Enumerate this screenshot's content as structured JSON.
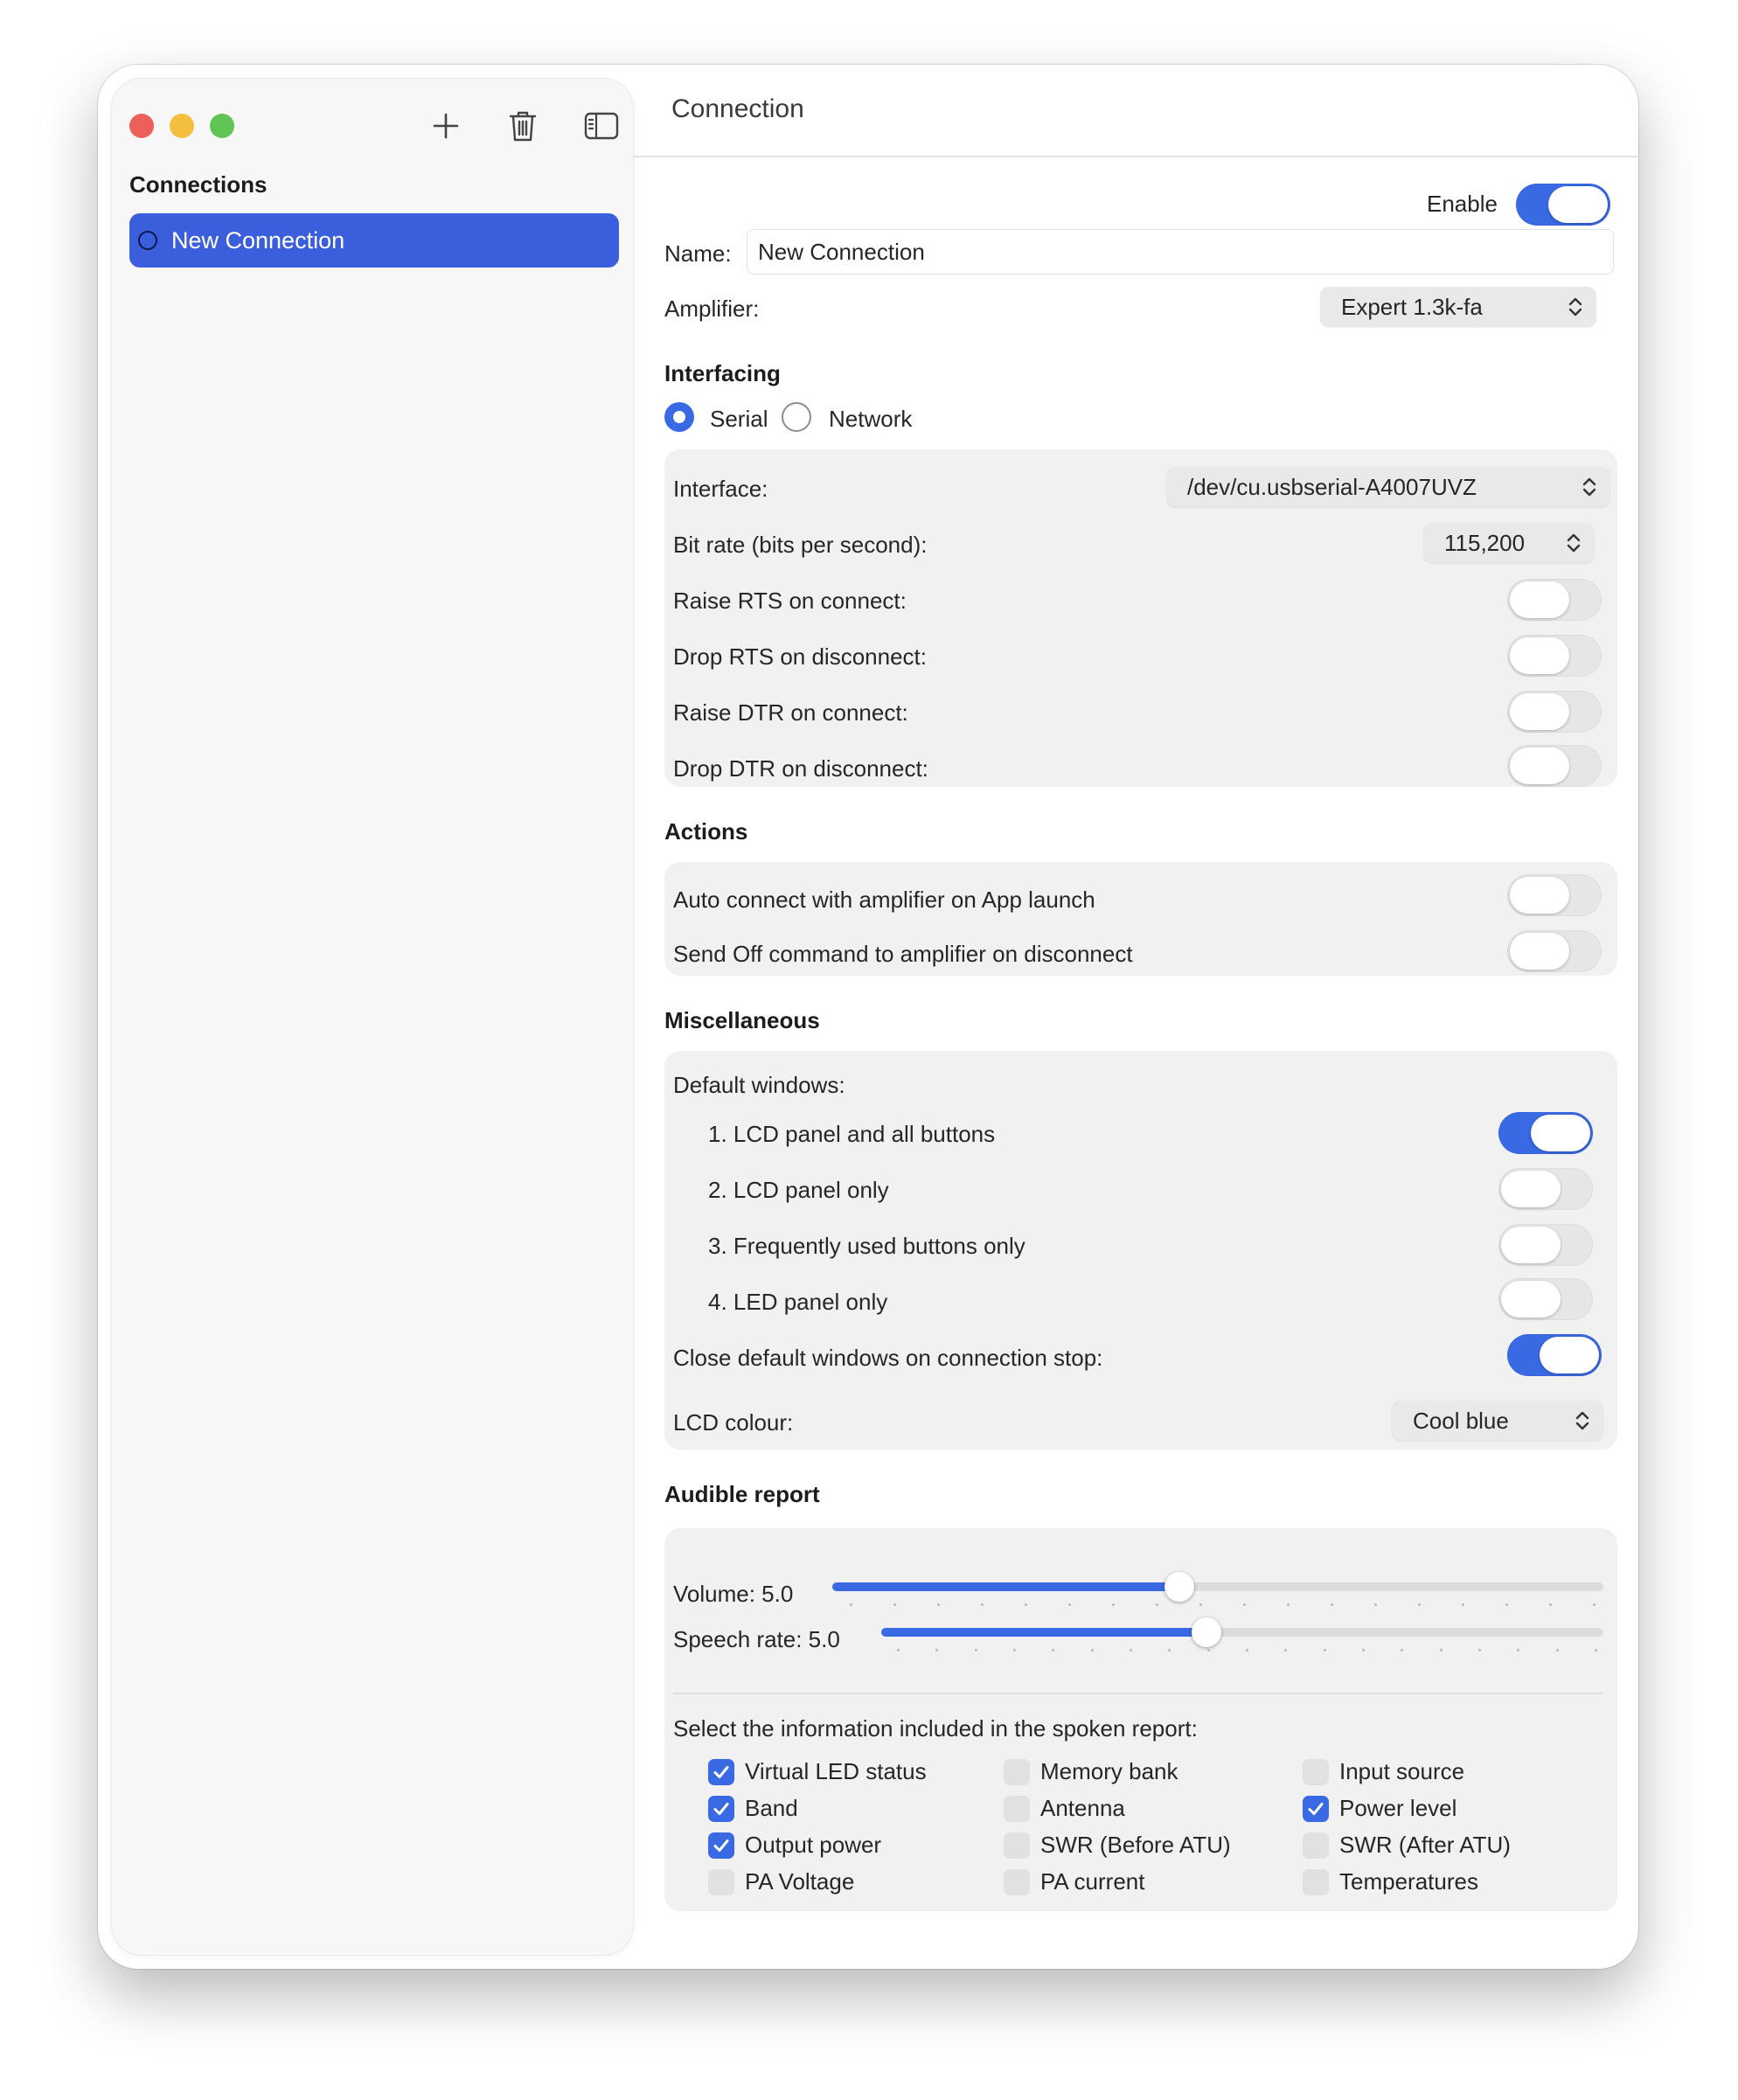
{
  "sidebar": {
    "heading": "Connections",
    "items": [
      {
        "label": "New Connection",
        "selected": true
      }
    ],
    "toolbar": {
      "add_icon": "plus-icon",
      "delete_icon": "trash-icon",
      "sidebar_icon": "sidebar-toggle-icon"
    }
  },
  "detail": {
    "title": "Connection",
    "enable": {
      "label": "Enable",
      "on": true
    },
    "name": {
      "label": "Name:",
      "value": "New Connection"
    },
    "amplifier": {
      "label": "Amplifier:",
      "value": "Expert 1.3k-fa"
    },
    "interfacing": {
      "heading": "Interfacing",
      "options": [
        {
          "label": "Serial",
          "selected": true
        },
        {
          "label": "Network",
          "selected": false
        }
      ],
      "interface": {
        "label": "Interface:",
        "value": "/dev/cu.usbserial-A4007UVZ"
      },
      "bitrate": {
        "label": "Bit rate (bits per second):",
        "value": "115,200"
      },
      "toggles": [
        {
          "label": "Raise RTS on connect:",
          "on": false
        },
        {
          "label": "Drop RTS on disconnect:",
          "on": false
        },
        {
          "label": "Raise DTR on connect:",
          "on": false
        },
        {
          "label": "Drop DTR on disconnect:",
          "on": false
        }
      ]
    },
    "actions": {
      "heading": "Actions",
      "toggles": [
        {
          "label": "Auto connect with amplifier on App launch",
          "on": false
        },
        {
          "label": "Send Off command to amplifier on disconnect",
          "on": false
        }
      ]
    },
    "misc": {
      "heading": "Miscellaneous",
      "default_windows_label": "Default windows:",
      "windows": [
        {
          "label": "1. LCD panel and all buttons",
          "on": true
        },
        {
          "label": "2. LCD panel only",
          "on": false
        },
        {
          "label": "3. Frequently used buttons only",
          "on": false
        },
        {
          "label": "4. LED panel only",
          "on": false
        }
      ],
      "close_default": {
        "label": "Close default windows on connection stop:",
        "on": true
      },
      "lcd_colour": {
        "label": "LCD colour:",
        "value": "Cool blue"
      }
    },
    "audible": {
      "heading": "Audible report",
      "volume": {
        "label": "Volume: 5.0",
        "fraction": 0.45
      },
      "speech_rate": {
        "label": "Speech rate: 5.0",
        "fraction": 0.45
      },
      "select_label": "Select the information included in the spoken report:",
      "checkboxes": [
        [
          {
            "label": "Virtual LED status",
            "checked": true
          },
          {
            "label": "Band",
            "checked": true
          },
          {
            "label": "Output power",
            "checked": true
          },
          {
            "label": "PA Voltage",
            "checked": false
          }
        ],
        [
          {
            "label": "Memory bank",
            "checked": false
          },
          {
            "label": "Antenna",
            "checked": false
          },
          {
            "label": "SWR (Before ATU)",
            "checked": false
          },
          {
            "label": "PA current",
            "checked": false
          }
        ],
        [
          {
            "label": "Input source",
            "checked": false
          },
          {
            "label": "Power level",
            "checked": true
          },
          {
            "label": "SWR (After ATU)",
            "checked": false
          },
          {
            "label": "Temperatures",
            "checked": false
          }
        ]
      ]
    }
  },
  "colors": {
    "accent": "#3a69e4",
    "selection": "#3b5fdc"
  }
}
